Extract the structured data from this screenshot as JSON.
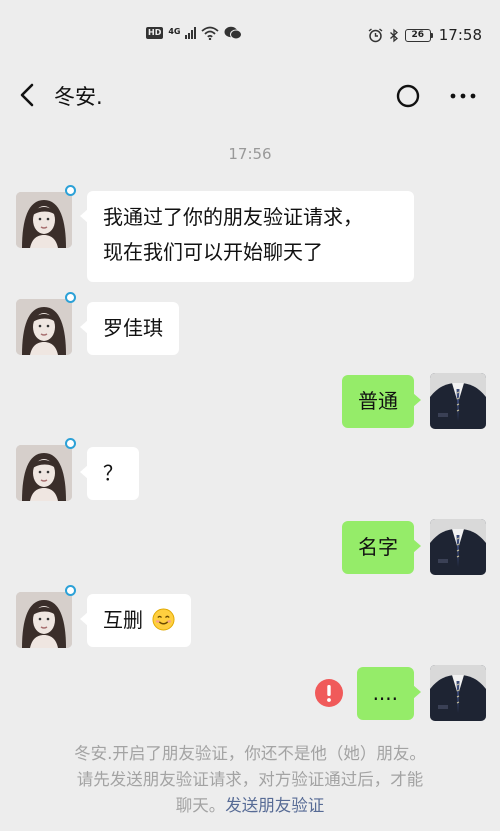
{
  "status_bar": {
    "hd": "HD",
    "network": "4G",
    "battery": "26",
    "time": "17:58"
  },
  "header": {
    "title": "冬安.",
    "back_icon": "chevron-left-icon",
    "refresh_icon": "circle-icon",
    "more_icon": "more-dots-icon"
  },
  "chat": {
    "timestamp": "17:56",
    "messages": [
      {
        "from": "contact",
        "lines": [
          "我通过了你的朋友验证请求，",
          "现在我们可以开始聊天了"
        ]
      },
      {
        "from": "contact",
        "text": "罗佳琪"
      },
      {
        "from": "me",
        "text": "普通"
      },
      {
        "from": "contact",
        "text": "？"
      },
      {
        "from": "me",
        "text": "名字"
      },
      {
        "from": "contact",
        "text": "互删",
        "emoji": "smile-emoji"
      },
      {
        "from": "me",
        "text": "....",
        "status": "failed"
      }
    ]
  },
  "notice": {
    "line1": "冬安.开启了朋友验证，你还不是他（她）朋友。",
    "line2": "请先发送朋友验证请求，对方验证通过后，才能",
    "line3": "聊天。",
    "link": "发送朋友验证"
  },
  "colors": {
    "background": "#ededed",
    "sent_bubble": "#95ec69",
    "received_bubble": "#ffffff",
    "link": "#576b95",
    "error": "#f05a5a",
    "notice_text": "#a3a3a3"
  }
}
